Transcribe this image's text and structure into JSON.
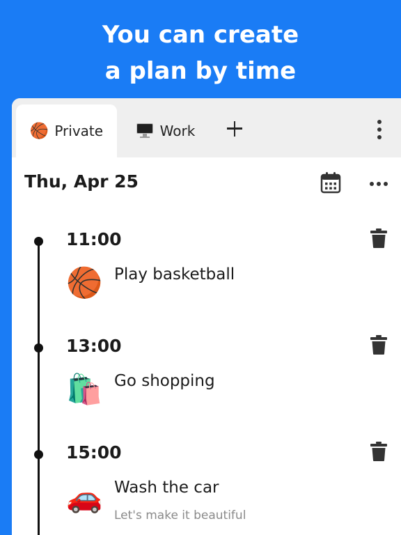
{
  "headline": {
    "line1": "You can create",
    "line2": "a plan by time"
  },
  "tabs": [
    {
      "label": "Private",
      "icon": "basketball-icon",
      "emoji": "🏀",
      "active": true
    },
    {
      "label": "Work",
      "icon": "monitor-icon",
      "active": false
    }
  ],
  "date_title": "Thu, Apr 25",
  "events": [
    {
      "time": "11:00",
      "title": "Play basketball",
      "icon": "basketball-icon",
      "emoji": "🏀",
      "subtitle": ""
    },
    {
      "time": "13:00",
      "title": "Go shopping",
      "icon": "shopping-bags-icon",
      "emoji": "🛍️",
      "subtitle": ""
    },
    {
      "time": "15:00",
      "title": "Wash the car",
      "icon": "car-icon",
      "emoji": "🚗",
      "subtitle": "Let's make it beautiful"
    }
  ],
  "colors": {
    "background": "#1a7cf5",
    "panel": "#ffffff",
    "tabbar": "#efefef",
    "timeline": "#111111",
    "subtitle": "#8a8a8a"
  }
}
